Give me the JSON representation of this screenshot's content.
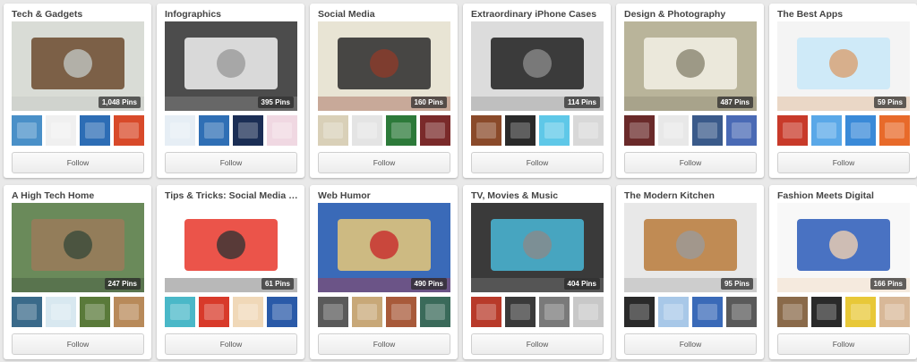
{
  "boards": [
    {
      "title": "Tech & Gadgets",
      "pins": "1,048 Pins",
      "follow_label": "Follow",
      "cover_colors": [
        "#d9dcd6",
        "#6b4a2e",
        "#bfc4c0"
      ],
      "thumb_colors": [
        "#4a90c8",
        "#f0f0f0",
        "#2d6db5",
        "#d84a2a"
      ]
    },
    {
      "title": "Infographics",
      "pins": "395 Pins",
      "follow_label": "Follow",
      "cover_colors": [
        "#4c4c4c",
        "#f2f2f2",
        "#9a9a9a"
      ],
      "thumb_colors": [
        "#e6eef5",
        "#2f6fb5",
        "#1b2e55",
        "#f0d8e2"
      ]
    },
    {
      "title": "Social Media",
      "pins": "160 Pins",
      "follow_label": "Follow",
      "cover_colors": [
        "#e8e4d4",
        "#2a2a2a",
        "#8c3b2a"
      ],
      "thumb_colors": [
        "#d9d0b8",
        "#e4e4e4",
        "#2d7a3a",
        "#7a2a2a"
      ]
    },
    {
      "title": "Extraordinary iPhone Cases",
      "pins": "114 Pins",
      "follow_label": "Follow",
      "cover_colors": [
        "#dcdcdc",
        "#1e1e1e",
        "#8a8a8a"
      ],
      "thumb_colors": [
        "#8a4a2a",
        "#2a2a2a",
        "#5fc8e8",
        "#d8d8d8"
      ]
    },
    {
      "title": "Design & Photography",
      "pins": "487 Pins",
      "follow_label": "Follow",
      "cover_colors": [
        "#b9b49a",
        "#f3f1e6",
        "#8a8570"
      ],
      "thumb_colors": [
        "#6a2a2a",
        "#e8e8e8",
        "#3a5a8a",
        "#4a6ab5"
      ]
    },
    {
      "title": "The Best Apps",
      "pins": "59 Pins",
      "follow_label": "Follow",
      "cover_colors": [
        "#f4f4f4",
        "#c8e8f8",
        "#d8a070"
      ],
      "thumb_colors": [
        "#c83a2a",
        "#5aa8e8",
        "#3a8ad8",
        "#e86a2a"
      ]
    },
    {
      "title": "A High Tech Home",
      "pins": "247 Pins",
      "follow_label": "Follow",
      "cover_colors": [
        "#6a8a5a",
        "#9a7a5a",
        "#3a4a3a"
      ],
      "thumb_colors": [
        "#3a6a8a",
        "#d8e8f0",
        "#5a7a3a",
        "#b88a5a"
      ]
    },
    {
      "title": "Tips & Tricks: Social Media a...",
      "pins": "61 Pins",
      "follow_label": "Follow",
      "cover_colors": [
        "#ffffff",
        "#e8362a",
        "#333333"
      ],
      "thumb_colors": [
        "#4ab8c8",
        "#d83a2a",
        "#f0d8b8",
        "#2a5aa8"
      ]
    },
    {
      "title": "Web Humor",
      "pins": "490 Pins",
      "follow_label": "Follow",
      "cover_colors": [
        "#3a6ab8",
        "#e8c878",
        "#c82a2a"
      ],
      "thumb_colors": [
        "#5a5a5a",
        "#c8a878",
        "#a85a3a",
        "#3a6a5a"
      ]
    },
    {
      "title": "TV, Movies & Music",
      "pins": "404 Pins",
      "follow_label": "Follow",
      "cover_colors": [
        "#3a3a3a",
        "#4ab8d8",
        "#8a8a8a"
      ],
      "thumb_colors": [
        "#b83a2a",
        "#3a3a3a",
        "#7a7a7a",
        "#c8c8c8"
      ]
    },
    {
      "title": "The Modern Kitchen",
      "pins": "95 Pins",
      "follow_label": "Follow",
      "cover_colors": [
        "#e8e8e8",
        "#b87a3a",
        "#9a9a9a"
      ],
      "thumb_colors": [
        "#2a2a2a",
        "#a8c8e8",
        "#3a6ab8",
        "#5a5a5a"
      ]
    },
    {
      "title": "Fashion Meets Digital",
      "pins": "166 Pins",
      "follow_label": "Follow",
      "cover_colors": [
        "#f8f8f8",
        "#2a5ab8",
        "#f0d0b0"
      ],
      "thumb_colors": [
        "#8a6a4a",
        "#2a2a2a",
        "#e8c838",
        "#d8b898"
      ]
    }
  ]
}
